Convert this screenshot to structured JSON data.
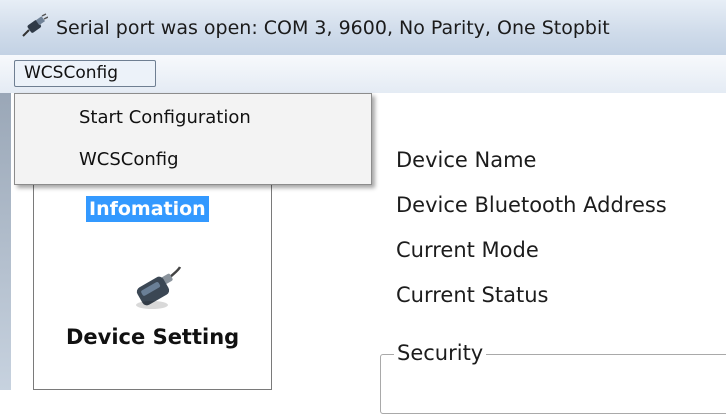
{
  "window": {
    "title": "Serial port was open: COM 3, 9600, No Parity, One Stopbit",
    "icon": "serial-port-plug-icon"
  },
  "menubar": {
    "menu_label": "WCSConfig"
  },
  "dropdown": {
    "items": [
      {
        "label": "Start Configuration"
      },
      {
        "label": "WCSConfig"
      }
    ]
  },
  "nav": {
    "info_label": "Infomation",
    "device_setting_label": "Device Setting",
    "device_icon": "usb-bluetooth-dongle-icon"
  },
  "details": {
    "fields": [
      {
        "label": "Device Name"
      },
      {
        "label": "Device Bluetooth Address"
      },
      {
        "label": "Current Mode"
      },
      {
        "label": "Current Status"
      }
    ],
    "security_label": "Security"
  },
  "colors": {
    "selection_highlight": "#3399ff",
    "titlebar": "#cfdbea"
  }
}
